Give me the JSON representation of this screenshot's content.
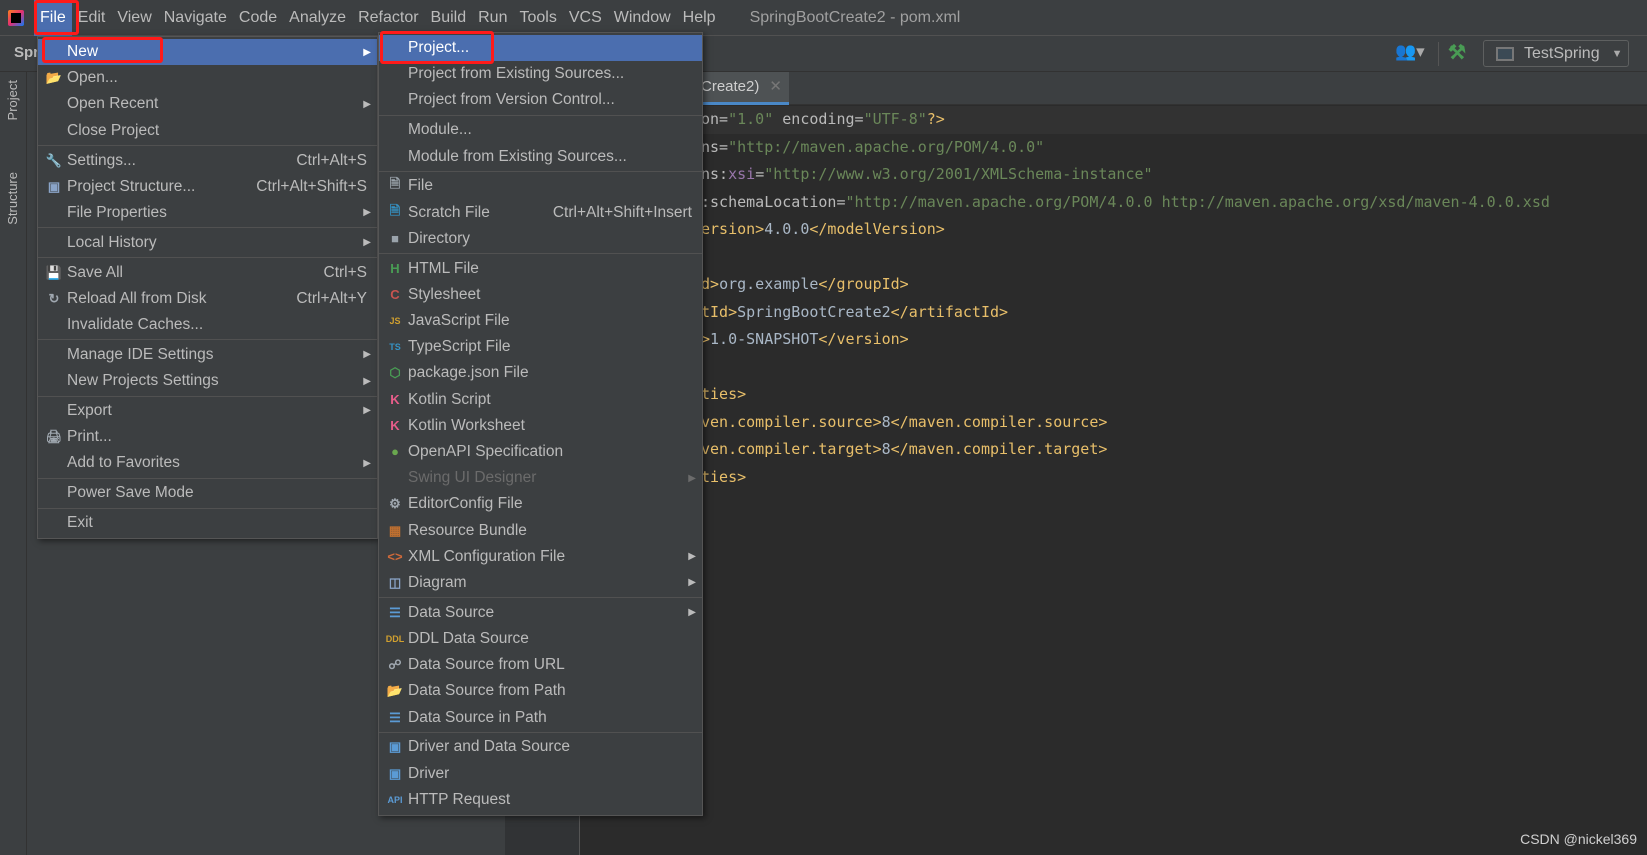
{
  "menubar": {
    "items": [
      "File",
      "Edit",
      "View",
      "Navigate",
      "Code",
      "Analyze",
      "Refactor",
      "Build",
      "Run",
      "Tools",
      "VCS",
      "Window",
      "Help"
    ],
    "active": "File",
    "window_title": "SpringBootCreate2 - pom.xml"
  },
  "toolbar": {
    "project_label": "Spr",
    "run_config": "TestSpring"
  },
  "toolstrip": {
    "project": "Project",
    "structure": "Structure"
  },
  "editor": {
    "tab_label": "Create2)",
    "lines": [
      [
        {
          "t": "on=",
          "c": "#bababa"
        },
        {
          "t": "\"1.0\"",
          "c": "#6a8759"
        },
        {
          "t": " encoding=",
          "c": "#bababa"
        },
        {
          "t": "\"UTF-8\"",
          "c": "#6a8759"
        },
        {
          "t": "?>",
          "c": "#e8bf6a"
        }
      ],
      [
        {
          "t": "ns=",
          "c": "#bababa"
        },
        {
          "t": "\"http://maven.apache.org/POM/4.0.0\"",
          "c": "#6a8759"
        }
      ],
      [
        {
          "t": "ns:",
          "c": "#bababa"
        },
        {
          "t": "xsi",
          "c": "#9876aa"
        },
        {
          "t": "=",
          "c": "#bababa"
        },
        {
          "t": "\"http://www.w3.org/2001/XMLSchema-instance\"",
          "c": "#6a8759"
        }
      ],
      [
        {
          "t": ":schemaLocation=",
          "c": "#bababa"
        },
        {
          "t": "\"http://maven.apache.org/POM/4.0.0 http://maven.apache.org/xsd/maven-4.0.0.xsd",
          "c": "#6a8759"
        }
      ],
      [
        {
          "t": "ersion>",
          "c": "#e8bf6a"
        },
        {
          "t": "4.0.0",
          "c": "#a9b7c6"
        },
        {
          "t": "</modelVersion>",
          "c": "#e8bf6a"
        }
      ],
      [],
      [
        {
          "t": "d>",
          "c": "#e8bf6a"
        },
        {
          "t": "org.example",
          "c": "#a9b7c6"
        },
        {
          "t": "</groupId>",
          "c": "#e8bf6a"
        }
      ],
      [
        {
          "t": "tId>",
          "c": "#e8bf6a"
        },
        {
          "t": "SpringBootCreate2",
          "c": "#a9b7c6"
        },
        {
          "t": "</artifactId>",
          "c": "#e8bf6a"
        }
      ],
      [
        {
          "t": ">",
          "c": "#e8bf6a"
        },
        {
          "t": "1.0-SNAPSHOT",
          "c": "#a9b7c6"
        },
        {
          "t": "</version>",
          "c": "#e8bf6a"
        }
      ],
      [],
      [
        {
          "t": "ties>",
          "c": "#e8bf6a"
        }
      ],
      [
        {
          "t": "ven.compiler.source>",
          "c": "#e8bf6a"
        },
        {
          "t": "8",
          "c": "#a9b7c6"
        },
        {
          "t": "</maven.compiler.source>",
          "c": "#e8bf6a"
        }
      ],
      [
        {
          "t": "ven.compiler.target>",
          "c": "#e8bf6a"
        },
        {
          "t": "8",
          "c": "#a9b7c6"
        },
        {
          "t": "</maven.compiler.target>",
          "c": "#e8bf6a"
        }
      ],
      [
        {
          "t": "ties>",
          "c": "#e8bf6a"
        }
      ]
    ]
  },
  "file_menu": [
    [
      {
        "label": "New",
        "sub": true,
        "sel": true
      },
      {
        "label": "Open...",
        "icon": "folder-icon"
      },
      {
        "label": "Open Recent",
        "sub": true
      },
      {
        "label": "Close Project"
      }
    ],
    [
      {
        "label": "Settings...",
        "shortcut": "Ctrl+Alt+S",
        "icon": "wrench-icon"
      },
      {
        "label": "Project Structure...",
        "shortcut": "Ctrl+Alt+Shift+S",
        "icon": "project-structure-icon"
      },
      {
        "label": "File Properties",
        "sub": true
      }
    ],
    [
      {
        "label": "Local History",
        "sub": true
      }
    ],
    [
      {
        "label": "Save All",
        "shortcut": "Ctrl+S",
        "icon": "save-icon"
      },
      {
        "label": "Reload All from Disk",
        "shortcut": "Ctrl+Alt+Y",
        "icon": "reload-icon"
      },
      {
        "label": "Invalidate Caches..."
      }
    ],
    [
      {
        "label": "Manage IDE Settings",
        "sub": true
      },
      {
        "label": "New Projects Settings",
        "sub": true
      }
    ],
    [
      {
        "label": "Export",
        "sub": true
      },
      {
        "label": "Print...",
        "icon": "print-icon"
      },
      {
        "label": "Add to Favorites",
        "sub": true
      }
    ],
    [
      {
        "label": "Power Save Mode"
      }
    ],
    [
      {
        "label": "Exit"
      }
    ]
  ],
  "new_menu": [
    [
      {
        "label": "Project...",
        "sel": true
      },
      {
        "label": "Project from Existing Sources..."
      },
      {
        "label": "Project from Version Control..."
      }
    ],
    [
      {
        "label": "Module..."
      },
      {
        "label": "Module from Existing Sources..."
      }
    ],
    [
      {
        "label": "File",
        "icon": "file-icon"
      },
      {
        "label": "Scratch File",
        "shortcut": "Ctrl+Alt+Shift+Insert",
        "icon": "scratch-file-icon"
      },
      {
        "label": "Directory",
        "icon": "directory-icon"
      }
    ],
    [
      {
        "label": "HTML File",
        "icon": "html-icon"
      },
      {
        "label": "Stylesheet",
        "icon": "css-icon"
      },
      {
        "label": "JavaScript File",
        "icon": "js-icon"
      },
      {
        "label": "TypeScript File",
        "icon": "ts-icon"
      },
      {
        "label": "package.json File",
        "icon": "nodejs-icon"
      },
      {
        "label": "Kotlin Script",
        "icon": "kotlin-icon"
      },
      {
        "label": "Kotlin Worksheet",
        "icon": "kotlin-icon"
      },
      {
        "label": "OpenAPI Specification",
        "icon": "openapi-icon"
      },
      {
        "label": "Swing UI Designer",
        "sub": true,
        "disabled": true
      },
      {
        "label": "EditorConfig File",
        "icon": "gear-icon"
      },
      {
        "label": "Resource Bundle",
        "icon": "resource-bundle-icon"
      },
      {
        "label": "XML Configuration File",
        "sub": true,
        "icon": "xml-icon"
      },
      {
        "label": "Diagram",
        "sub": true,
        "icon": "diagram-icon"
      }
    ],
    [
      {
        "label": "Data Source",
        "sub": true,
        "icon": "database-icon"
      },
      {
        "label": "DDL Data Source",
        "icon": "ddl-icon"
      },
      {
        "label": "Data Source from URL",
        "icon": "url-plug-icon"
      },
      {
        "label": "Data Source from Path",
        "icon": "folder-icon"
      },
      {
        "label": "Data Source in Path",
        "icon": "database-icon"
      }
    ],
    [
      {
        "label": "Driver and Data Source",
        "icon": "driver-icon"
      },
      {
        "label": "Driver",
        "icon": "driver-icon"
      },
      {
        "label": "HTTP Request",
        "icon": "api-icon"
      }
    ]
  ],
  "watermark": "CSDN @nickel369",
  "colors": {
    "menu_bg": "#3c3f41",
    "selection": "#4b6eaf",
    "highlight_box": "#ff1a1a",
    "editor_bg": "#2b2b2b"
  }
}
